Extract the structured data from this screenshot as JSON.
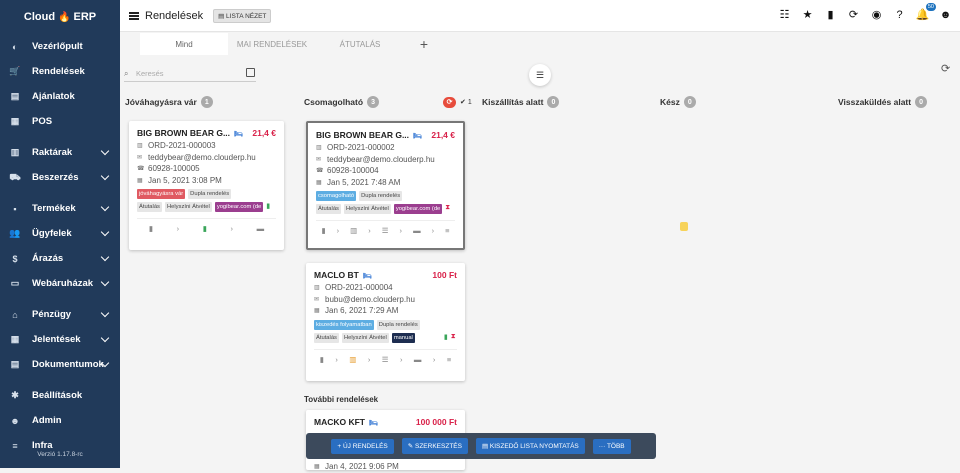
{
  "app": {
    "logo": "Cloud",
    "logo_suffix": "ERP",
    "version": "Verzió 1.17.8-rc"
  },
  "sidebar": {
    "items": [
      {
        "label": "Vezérlőpult",
        "icon": "dashboard-icon",
        "glyph": "◐",
        "chevron": false
      },
      {
        "label": "Rendelések",
        "icon": "cart-icon",
        "glyph": "🛒",
        "chevron": false
      },
      {
        "label": "Ajánlatok",
        "icon": "document-icon",
        "glyph": "▤",
        "chevron": false
      },
      {
        "label": "POS",
        "icon": "pos-icon",
        "glyph": "▦",
        "chevron": false
      },
      {
        "label": "Raktárak",
        "icon": "warehouse-icon",
        "glyph": "▥",
        "chevron": true
      },
      {
        "label": "Beszerzés",
        "icon": "truck-icon",
        "glyph": "⛟",
        "chevron": true
      },
      {
        "label": "Termékek",
        "icon": "products-icon",
        "glyph": "▪",
        "chevron": true
      },
      {
        "label": "Ügyfelek",
        "icon": "users-icon",
        "glyph": "👥",
        "chevron": true
      },
      {
        "label": "Árazás",
        "icon": "dollar-icon",
        "glyph": "$",
        "chevron": true
      },
      {
        "label": "Webáruházak",
        "icon": "store-icon",
        "glyph": "▭",
        "chevron": true
      },
      {
        "label": "Pénzügy",
        "icon": "bank-icon",
        "glyph": "⌂",
        "chevron": true
      },
      {
        "label": "Jelentések",
        "icon": "table-icon",
        "glyph": "▦",
        "chevron": true
      },
      {
        "label": "Dokumentumok",
        "icon": "file-icon",
        "glyph": "▤",
        "chevron": true
      },
      {
        "label": "Beállítások",
        "icon": "gear-icon",
        "glyph": "✱",
        "chevron": false
      },
      {
        "label": "Admin",
        "icon": "admin-icon",
        "glyph": "☻",
        "chevron": false
      },
      {
        "label": "Infra",
        "icon": "server-icon",
        "glyph": "≡",
        "chevron": false
      }
    ]
  },
  "header": {
    "title": "Rendelések",
    "view_button": "LISTA NÉZET",
    "notification_count": "50"
  },
  "tabs": [
    "Mind",
    "MAI RENDELÉSEK",
    "ÁTUTALÁS"
  ],
  "search": {
    "placeholder": "Keresés"
  },
  "columns": [
    {
      "title": "Jóváhagyásra vár",
      "count": "1"
    },
    {
      "title": "Csomagolható",
      "count": "3",
      "checked": "1"
    },
    {
      "title": "Kiszállítás alatt",
      "count": "0"
    },
    {
      "title": "Kész",
      "count": "0"
    },
    {
      "title": "Visszaküldés alatt",
      "count": "0"
    }
  ],
  "cards": [
    {
      "name": "BIG BROWN BEAR G...",
      "price": "21,4 €",
      "order": "ORD-2021-000003",
      "email": "teddybear@demo.clouderp.hu",
      "phone": "60928-100005",
      "date": "Jan 5, 2021 3:08 PM",
      "status": "jóváhagyásra vár",
      "tag2": "Dupla rendelés",
      "t1": "Átutalás",
      "t2": "Helyszíni Átvétel",
      "t3": "yogibear.com (de"
    },
    {
      "name": "BIG BROWN BEAR G...",
      "price": "21,4 €",
      "order": "ORD-2021-000002",
      "email": "teddybear@demo.clouderp.hu",
      "phone": "60928-100004",
      "date": "Jan 5, 2021 7:48 AM",
      "status": "csomagolható",
      "tag2": "Dupla rendelés",
      "t1": "Átutalás",
      "t2": "Helyszíni Átvétel",
      "t3": "yogibear.com (de"
    },
    {
      "name": "MACLO BT",
      "price": "100 Ft",
      "order": "ORD-2021-000004",
      "email": "bubu@demo.clouderp.hu",
      "date": "Jan 6, 2021 7:29 AM",
      "status": "kiszedés folyamatban",
      "tag2": "Dupla rendelés",
      "t1": "Átutalás",
      "t2": "Helyszíni Átvétel",
      "t3": "manual"
    },
    {
      "name": "MACKO KFT",
      "price": "100 000 Ft",
      "date": "Jan 4, 2021 9:06 PM"
    }
  ],
  "more_orders": "További rendelések",
  "bottom_bar": [
    "+ ÚJ RENDELÉS",
    "✎ SZERKESZTÉS",
    "▤ KISZEDŐ LISTA NYOMTATÁS",
    "··· TÖBB"
  ],
  "colors": {
    "sidebar": "#213a5a",
    "accent": "#2a6ec1",
    "price": "#d9224a"
  }
}
